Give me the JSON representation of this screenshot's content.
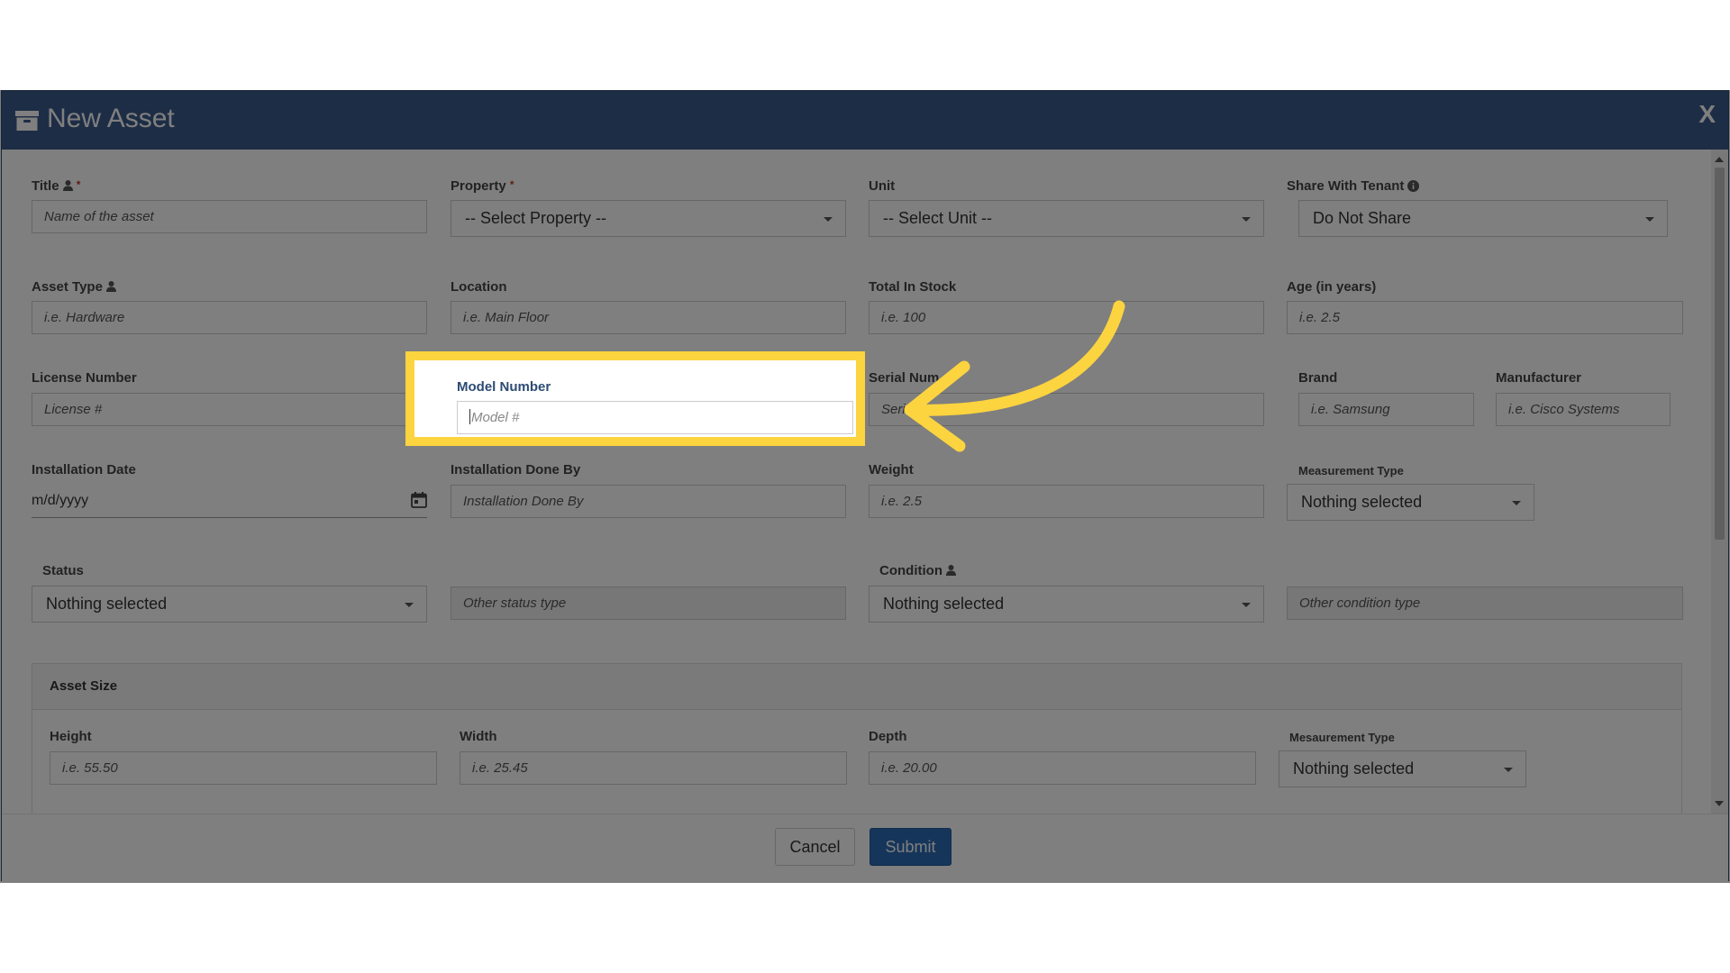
{
  "modal": {
    "title": "New Asset",
    "close_label": "X"
  },
  "fields": {
    "title": {
      "label": "Title",
      "required": "*",
      "placeholder": "Name of the asset"
    },
    "property": {
      "label": "Property",
      "required": "*",
      "value": "-- Select Property --"
    },
    "unit": {
      "label": "Unit",
      "value": "-- Select Unit --"
    },
    "share_with_tenant": {
      "label": "Share With Tenant",
      "value": "Do Not Share"
    },
    "asset_type": {
      "label": "Asset Type",
      "placeholder": "i.e. Hardware"
    },
    "location": {
      "label": "Location",
      "placeholder": "i.e. Main Floor"
    },
    "total_in_stock": {
      "label": "Total In Stock",
      "placeholder": "i.e. 100"
    },
    "age": {
      "label": "Age (in years)",
      "placeholder": "i.e. 2.5"
    },
    "license_number": {
      "label": "License Number",
      "placeholder": "License #"
    },
    "model_number": {
      "label": "Model Number",
      "placeholder": "Model #"
    },
    "serial_number": {
      "label": "Serial Num",
      "placeholder": "Seri"
    },
    "brand": {
      "label": "Brand",
      "placeholder": "i.e. Samsung"
    },
    "manufacturer": {
      "label": "Manufacturer",
      "placeholder": "i.e. Cisco Systems"
    },
    "installation_date": {
      "label": "Installation Date",
      "placeholder": "m/d/yyyy"
    },
    "installation_done_by": {
      "label": "Installation Done By",
      "placeholder": "Installation Done By"
    },
    "weight": {
      "label": "Weight",
      "placeholder": "i.e. 2.5"
    },
    "measurement_type": {
      "label": "Measurement Type",
      "value": "Nothing selected"
    },
    "status": {
      "label": "Status",
      "value": "Nothing selected"
    },
    "other_status": {
      "placeholder": "Other status type"
    },
    "condition": {
      "label": "Condition",
      "value": "Nothing selected"
    },
    "other_condition": {
      "placeholder": "Other condition type"
    }
  },
  "asset_size": {
    "title": "Asset Size",
    "height": {
      "label": "Height",
      "placeholder": "i.e. 55.50"
    },
    "width": {
      "label": "Width",
      "placeholder": "i.e. 25.45"
    },
    "depth": {
      "label": "Depth",
      "placeholder": "i.e. 20.00"
    },
    "measurement_type": {
      "label": "Mesaurement Type",
      "value": "Nothing selected"
    }
  },
  "footer": {
    "cancel_label": "Cancel",
    "submit_label": "Submit"
  },
  "colors": {
    "header": "#3a5a8c",
    "highlight": "#fcd43f",
    "submit": "#2d6ab5"
  },
  "icons": {
    "header": "archive-box-icon",
    "person": "user-icon",
    "info": "info-circle-icon",
    "calendar": "calendar-icon"
  }
}
